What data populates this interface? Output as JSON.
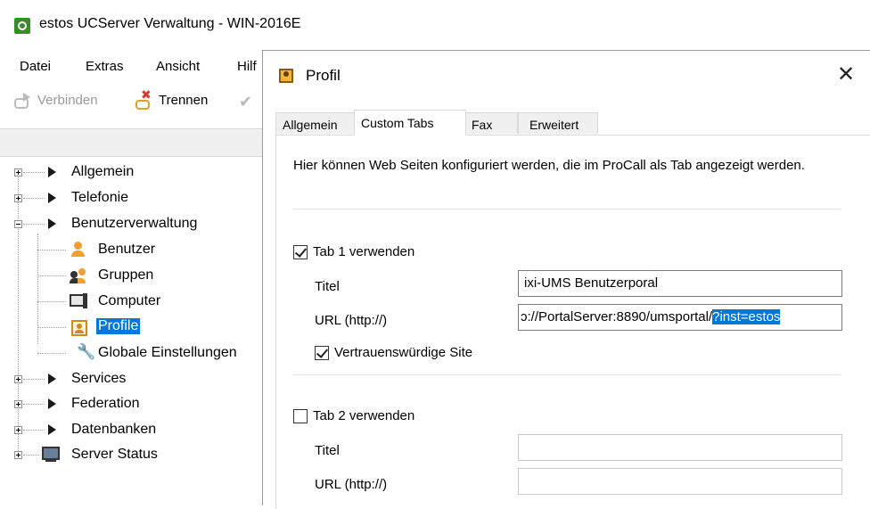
{
  "main_window": {
    "title": "estos UCServer Verwaltung - WIN-2016E",
    "menu": [
      "Datei",
      "Extras",
      "Ansicht",
      "Hilf"
    ],
    "toolbar": {
      "connect_label": "Verbinden",
      "disconnect_label": "Trennen"
    }
  },
  "tree": {
    "items": [
      {
        "label": "Allgemein",
        "icon": "triangle-right-icon",
        "expander": "plus"
      },
      {
        "label": "Telefonie",
        "icon": "triangle-right-icon",
        "expander": "plus"
      },
      {
        "label": "Benutzerverwaltung",
        "icon": "triangle-right-icon",
        "expander": "minus"
      },
      {
        "label": "Benutzer",
        "icon": "user-icon"
      },
      {
        "label": "Gruppen",
        "icon": "group-icon"
      },
      {
        "label": "Computer",
        "icon": "computer-icon"
      },
      {
        "label": "Profile",
        "icon": "profile-icon",
        "selected": true
      },
      {
        "label": "Globale Einstellungen",
        "icon": "wrench-icon"
      },
      {
        "label": "Services",
        "icon": "triangle-right-icon",
        "expander": "plus"
      },
      {
        "label": "Federation",
        "icon": "triangle-right-icon",
        "expander": "plus"
      },
      {
        "label": "Datenbanken",
        "icon": "triangle-right-icon",
        "expander": "plus"
      },
      {
        "label": "Server Status",
        "icon": "monitor-icon",
        "expander": "plus"
      }
    ]
  },
  "dialog": {
    "title": "Profil",
    "tabs": [
      "Allgemein",
      "Custom Tabs",
      "Fax",
      "Erweitert"
    ],
    "active_tab": "Custom Tabs",
    "intro": "Hier können Web Seiten konfiguriert werden, die im ProCall als Tab angezeigt werden.",
    "tab1": {
      "enable_label": "Tab 1 verwenden",
      "enabled": true,
      "title_label": "Titel",
      "title_value": "ixi-UMS Benutzerporal",
      "url_label": "URL (http://)",
      "url_value_visible": "ɔ://PortalServer:8890/umsportal/",
      "url_value_selected": "?inst=estos",
      "trusted_label": "Vertrauenswürdige Site",
      "trusted": true
    },
    "tab2": {
      "enable_label": "Tab 2 verwenden",
      "enabled": false,
      "title_label": "Titel",
      "title_value": "",
      "url_label": "URL (http://)",
      "url_value": ""
    }
  },
  "colors": {
    "selection": "#0078d7",
    "app_icon": "#3c8a2e"
  }
}
